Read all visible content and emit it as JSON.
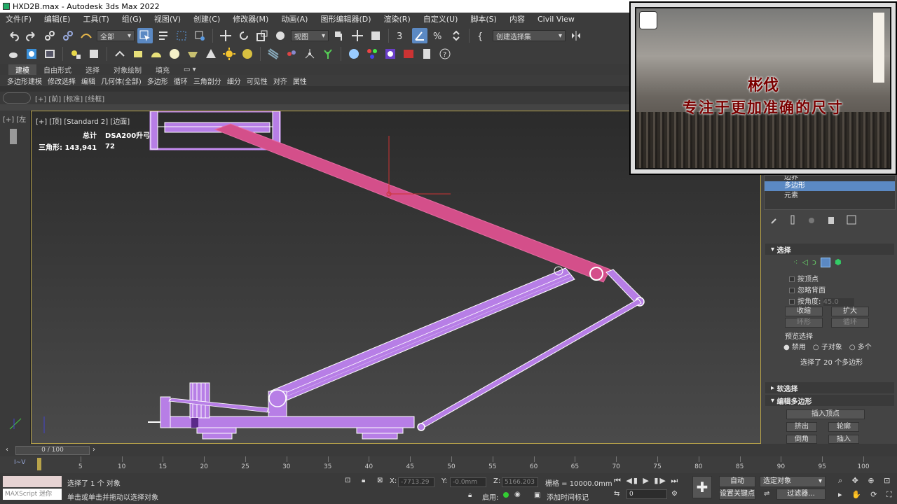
{
  "window": {
    "title": "HXD2B.max - Autodesk 3ds Max 2022"
  },
  "menu": [
    "文件(F)",
    "编辑(E)",
    "工具(T)",
    "组(G)",
    "视图(V)",
    "创建(C)",
    "修改器(M)",
    "动画(A)",
    "图形编辑器(D)",
    "渲染(R)",
    "自定义(U)",
    "脚本(S)",
    "内容",
    "Civil View"
  ],
  "toolbar": {
    "filter_combo": "全部",
    "view_combo": "视图",
    "selection_set_combo": "创建选择集"
  },
  "ribbon": {
    "tabs": [
      "建模",
      "自由形式",
      "选择",
      "对象绘制",
      "填充"
    ],
    "items": [
      "多边形建模",
      "修改选择",
      "编辑",
      "几何体(全部)",
      "多边形",
      "循环",
      "三角剖分",
      "细分",
      "可见性",
      "对齐",
      "属性"
    ]
  },
  "viewports": {
    "top_bar": "[+] [前] [标准] [线框]",
    "left_label": "[+] [左",
    "main_label": "[+] [顶] [Standard 2] [边面]",
    "stats": {
      "total_label": "总计",
      "object_name": "DSA200升弓",
      "tri_label": "三角形:",
      "tri_total": "143,941",
      "tri_object": "72"
    }
  },
  "overlay": {
    "line1": "彬伐",
    "line2": "专注于更加准确的尺寸"
  },
  "command_panel": {
    "stack_items": [
      "边界",
      "多边形",
      "元素"
    ],
    "selection_rollout": "选择",
    "options": [
      "按顶点",
      "忽略背面",
      "按角度:"
    ],
    "angle_value": "45.0",
    "shrink": "收缩",
    "grow": "扩大",
    "ring": "环形",
    "loop": "循环",
    "preview_label": "预览选择",
    "preview_options": [
      "禁用",
      "子对象",
      "多个"
    ],
    "selected_count": "选择了 20 个多边形",
    "soft_selection": "软选择",
    "edit_poly": "编辑多边形",
    "insert_vertex": "插入顶点",
    "extrude": "挤出",
    "outline": "轮廓",
    "bevel": "倒角",
    "inset": "插入"
  },
  "timeline": {
    "frame_display": "0 / 100",
    "ticks": [
      "5",
      "10",
      "15",
      "20",
      "25",
      "30",
      "35",
      "40",
      "45",
      "50",
      "55",
      "60",
      "65",
      "70",
      "75",
      "80",
      "85",
      "90",
      "95",
      "100"
    ]
  },
  "status": {
    "maxscript_hint": "MAXScript 迷你",
    "selected": "选择了 1 个 对象",
    "prompt": "单击或单击并拖动以选择对象",
    "x_label": "X:",
    "x_value": "-7713.29",
    "y_label": "Y:",
    "y_value": "-0.0mm",
    "z_label": "Z:",
    "z_value": "5166.203",
    "grid": "栅格 = 10000.0mm",
    "enable": "启用:",
    "add_time_tag": "添加时间标记",
    "auto_key": "自动",
    "set_key": "设置关键点",
    "selected_objects": "选定对象",
    "filters": "过滤器...",
    "frame": "0"
  },
  "colors": {
    "accent": "#5b89c3",
    "mesh_purple": "#b77ee6",
    "mesh_pink": "#d44f8a",
    "viewport_border": "#b8a34a"
  }
}
